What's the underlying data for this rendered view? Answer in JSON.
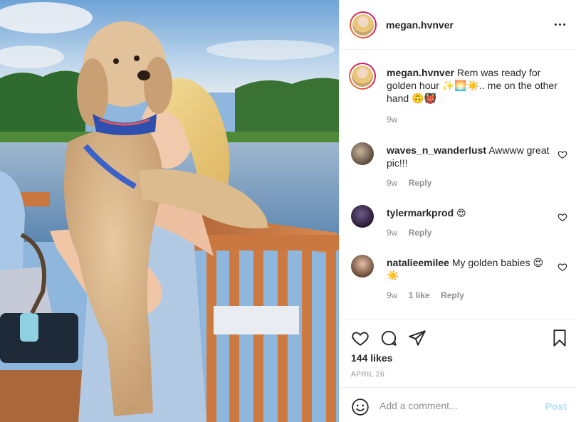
{
  "post": {
    "username": "megan.hvnver",
    "caption_text": "Rem was ready for golden hour ✨🌅☀️.. me on the other hand 🙃👹",
    "caption_time": "9w",
    "likes": "144 likes",
    "date": "APRIL 26"
  },
  "comments": [
    {
      "user": "waves_n_wanderlust",
      "text": "Awwww great pic!!!",
      "time": "9w",
      "likes": "",
      "reply": "Reply"
    },
    {
      "user": "tylermarkprod",
      "text": "😍",
      "time": "9w",
      "likes": "",
      "reply": "Reply"
    },
    {
      "user": "natalieemilee",
      "text": "My golden babies 😍 ☀️",
      "time": "9w",
      "likes": "1 like",
      "reply": "Reply"
    }
  ],
  "add_comment": {
    "placeholder": "Add a comment...",
    "post_label": "Post"
  },
  "icons": {
    "more": "more-options-icon",
    "like": "heart-icon",
    "comment": "comment-icon",
    "share": "paper-plane-icon",
    "save": "bookmark-icon",
    "emoji": "smiley-icon"
  },
  "colors": {
    "link_blue_disabled": "#b2dffc",
    "muted": "#8e8e8e",
    "text": "#262626",
    "border": "#efefef"
  }
}
